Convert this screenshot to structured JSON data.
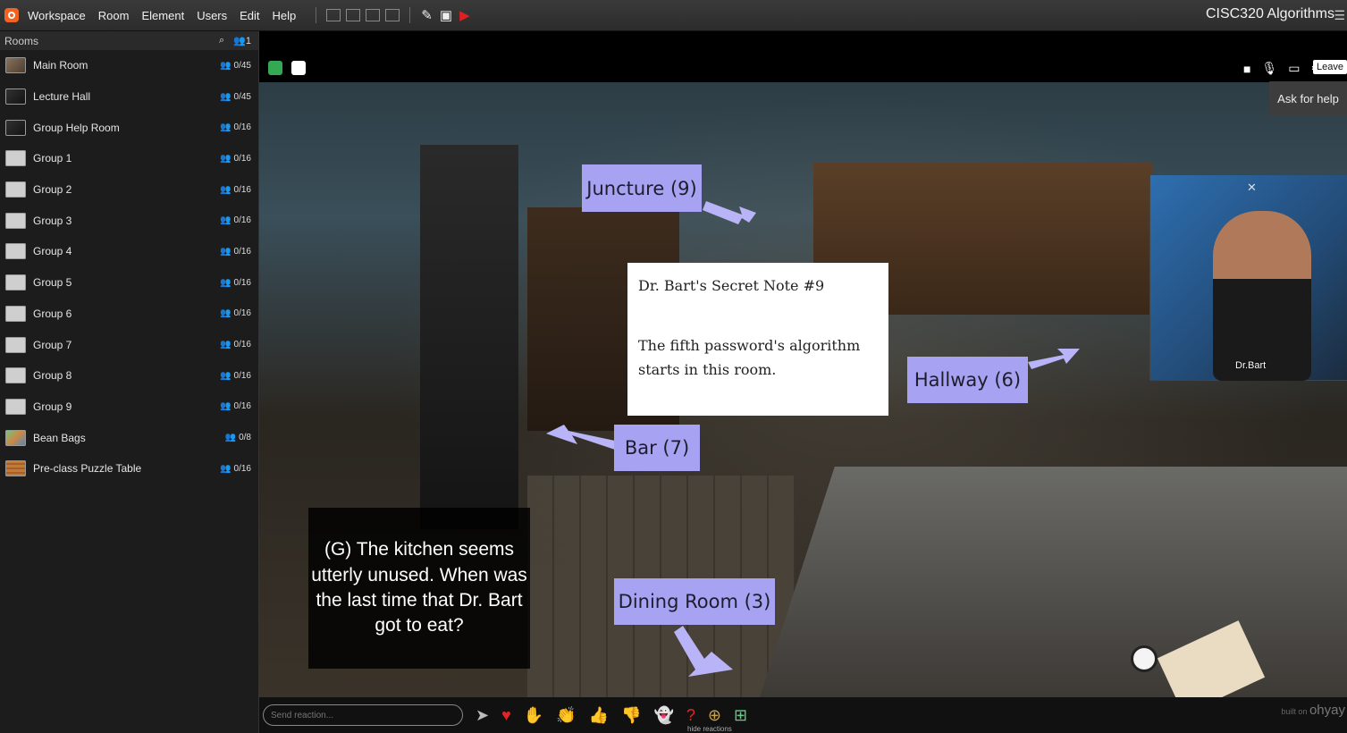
{
  "menu": [
    "Workspace",
    "Room",
    "Element",
    "Users",
    "Edit",
    "Help"
  ],
  "app_title": "CISC320 Algorithms",
  "sidebar": {
    "header": "Rooms",
    "user_count": "1",
    "rooms": [
      {
        "name": "Main Room",
        "count": "0/45",
        "thumb": "photo"
      },
      {
        "name": "Lecture Hall",
        "count": "0/45",
        "thumb": "dark"
      },
      {
        "name": "Group Help Room",
        "count": "0/16",
        "thumb": "dark"
      },
      {
        "name": "Group 1",
        "count": "0/16",
        "thumb": "plain"
      },
      {
        "name": "Group 2",
        "count": "0/16",
        "thumb": "plain"
      },
      {
        "name": "Group 3",
        "count": "0/16",
        "thumb": "plain"
      },
      {
        "name": "Group 4",
        "count": "0/16",
        "thumb": "plain"
      },
      {
        "name": "Group 5",
        "count": "0/16",
        "thumb": "plain"
      },
      {
        "name": "Group 6",
        "count": "0/16",
        "thumb": "plain"
      },
      {
        "name": "Group 7",
        "count": "0/16",
        "thumb": "plain"
      },
      {
        "name": "Group 8",
        "count": "0/16",
        "thumb": "plain"
      },
      {
        "name": "Group 9",
        "count": "0/16",
        "thumb": "plain"
      },
      {
        "name": "Bean Bags",
        "count": "0/8",
        "thumb": "colorful"
      },
      {
        "name": "Pre-class Puzzle Table",
        "count": "0/16",
        "thumb": "wood"
      }
    ]
  },
  "room_controls": {
    "leave": "Leave",
    "ask_help": "Ask for help"
  },
  "video": {
    "name": "Dr.Bart"
  },
  "scene": {
    "exits": [
      {
        "label": "Juncture (9)"
      },
      {
        "label": "Hallway (6)"
      },
      {
        "label": "Bar (7)"
      },
      {
        "label": "Dining Room (3)"
      }
    ],
    "note_title": "Dr. Bart's Secret Note #9",
    "note_body": "The fifth password's algorithm starts in this room.",
    "caption": "(G) The kitchen seems utterly unused. When was the last time that Dr. Bart got to eat?"
  },
  "reactions": {
    "placeholder": "Send reaction...",
    "hide_label": "hide reactions",
    "built_on": "built on",
    "brand": "ohyay"
  }
}
